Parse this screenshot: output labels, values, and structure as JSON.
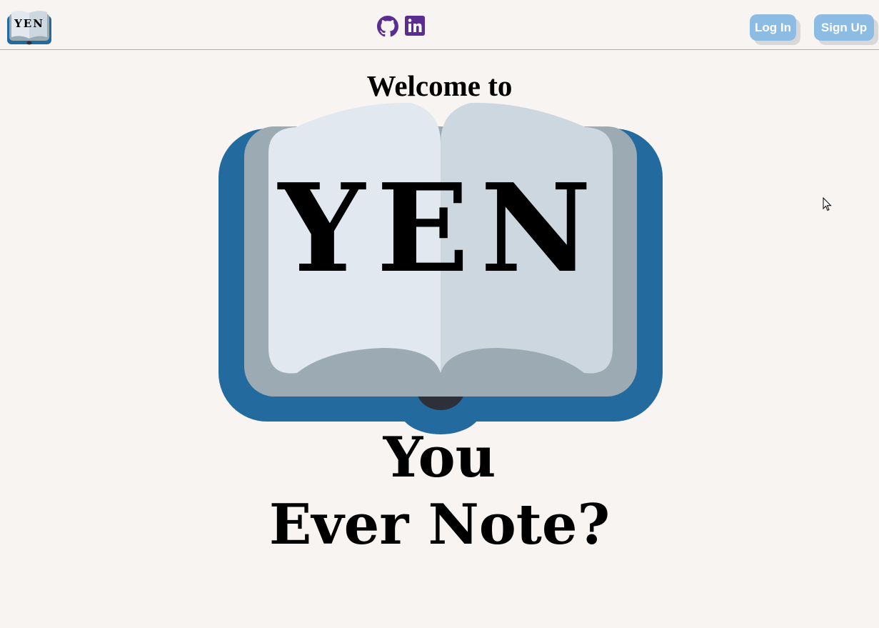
{
  "navbar": {
    "logo": {
      "text": "YEN",
      "icon": "open-book-icon",
      "colors": {
        "cover": "#236a9f",
        "page_edge": "#9caab3",
        "page": "#e1e8ef"
      }
    },
    "social_links": [
      {
        "icon": "github-icon",
        "color": "#5b2d91"
      },
      {
        "icon": "linkedin-icon",
        "color": "#5b2d91"
      }
    ],
    "buttons": {
      "login_label": "Log In",
      "signup_label": "Sign Up",
      "color": "#8cbce3"
    }
  },
  "hero": {
    "welcome_text": "Welcome to",
    "logo_text": "YEN",
    "tagline_line1": "You",
    "tagline_line2": "Ever Note?"
  },
  "colors": {
    "background": "#f8f4f1",
    "navbar_border": "#8fb3d6",
    "text": "#000000"
  }
}
